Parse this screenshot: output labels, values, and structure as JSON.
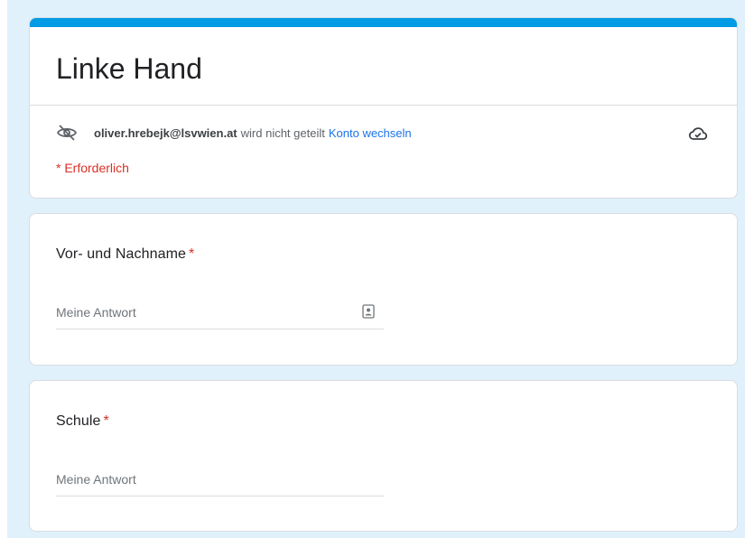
{
  "form": {
    "title": "Linke Hand",
    "accent_color": "#039be5",
    "background_color": "#e0f1fc"
  },
  "account": {
    "email": "oliver.hrebejk@lsvwien.at",
    "status_text": "wird nicht geteilt",
    "switch_link": "Konto wechseln",
    "privacy_icon": "eye-off-icon",
    "save_icon": "cloud-check-icon"
  },
  "required_note": "* Erforderlich",
  "questions": [
    {
      "label": "Vor- und Nachname",
      "required_mark": "*",
      "placeholder": "Meine Antwort",
      "value": "",
      "autofill_icon": "contact-card-icon"
    },
    {
      "label": "Schule",
      "required_mark": "*",
      "placeholder": "Meine Antwort",
      "value": ""
    }
  ]
}
